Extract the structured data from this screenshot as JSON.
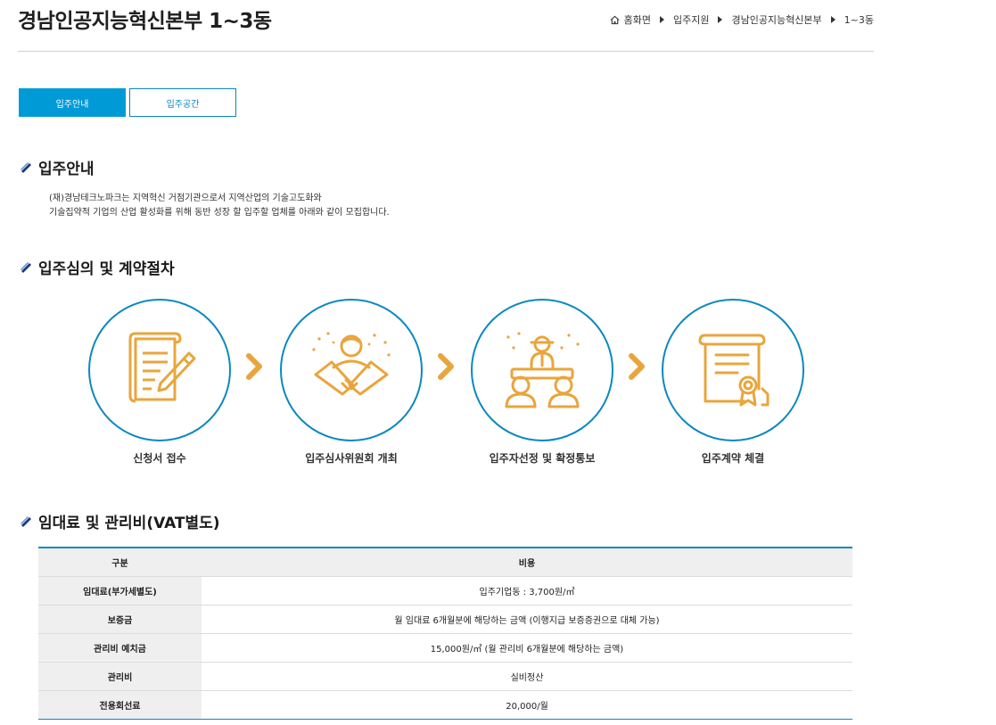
{
  "header": {
    "title": "경남인공지능혁신본부 1~3동",
    "breadcrumb": [
      "홈화면",
      "입주지원",
      "경남인공지능혁신본부",
      "1~3동"
    ]
  },
  "tabs": [
    {
      "label": "입주안내",
      "active": true
    },
    {
      "label": "입주공간",
      "active": false
    }
  ],
  "intro_section": {
    "heading": "입주안내",
    "lines": [
      "(재)경남테크노파크는 지역혁신 거점기관으로서 지역산업의 기술고도화와",
      "기술집약적 기업의 산업 활성화를 위해 동반 성장 할 입주할 업체를 아래와 같이 모집합니다."
    ]
  },
  "process_section": {
    "heading": "입주심의 및 계약절차",
    "steps": [
      {
        "label": "신청서 접수",
        "icon": "application-form-icon"
      },
      {
        "label": "입주심사위원회 개최",
        "icon": "handshake-icon"
      },
      {
        "label": "입주자선정 및 확정통보",
        "icon": "meeting-icon"
      },
      {
        "label": "입주계약 체결",
        "icon": "certificate-icon"
      }
    ]
  },
  "fee_section": {
    "heading": "임대료 및 관리비(VAT별도)",
    "columns": [
      "구분",
      "비용"
    ],
    "rows": [
      {
        "label": "임대료(부가세별도)",
        "value": "입주기업동 : 3,700원/㎡"
      },
      {
        "label": "보증금",
        "value": "월 임대료 6개월분에 해당하는 금액 (이행지급 보증증권으로 대체 가능)"
      },
      {
        "label": "관리비 예치금",
        "value": "15,000원/㎡ (월 관리비 6개월분에 해당하는 금액)"
      },
      {
        "label": "관리비",
        "value": "실비정산"
      },
      {
        "label": "전용회선료",
        "value": "20,000/월"
      }
    ]
  },
  "colors": {
    "accent_blue": "#009ad7",
    "border_blue": "#0b89bf",
    "icon_orange": "#e9a53d"
  }
}
